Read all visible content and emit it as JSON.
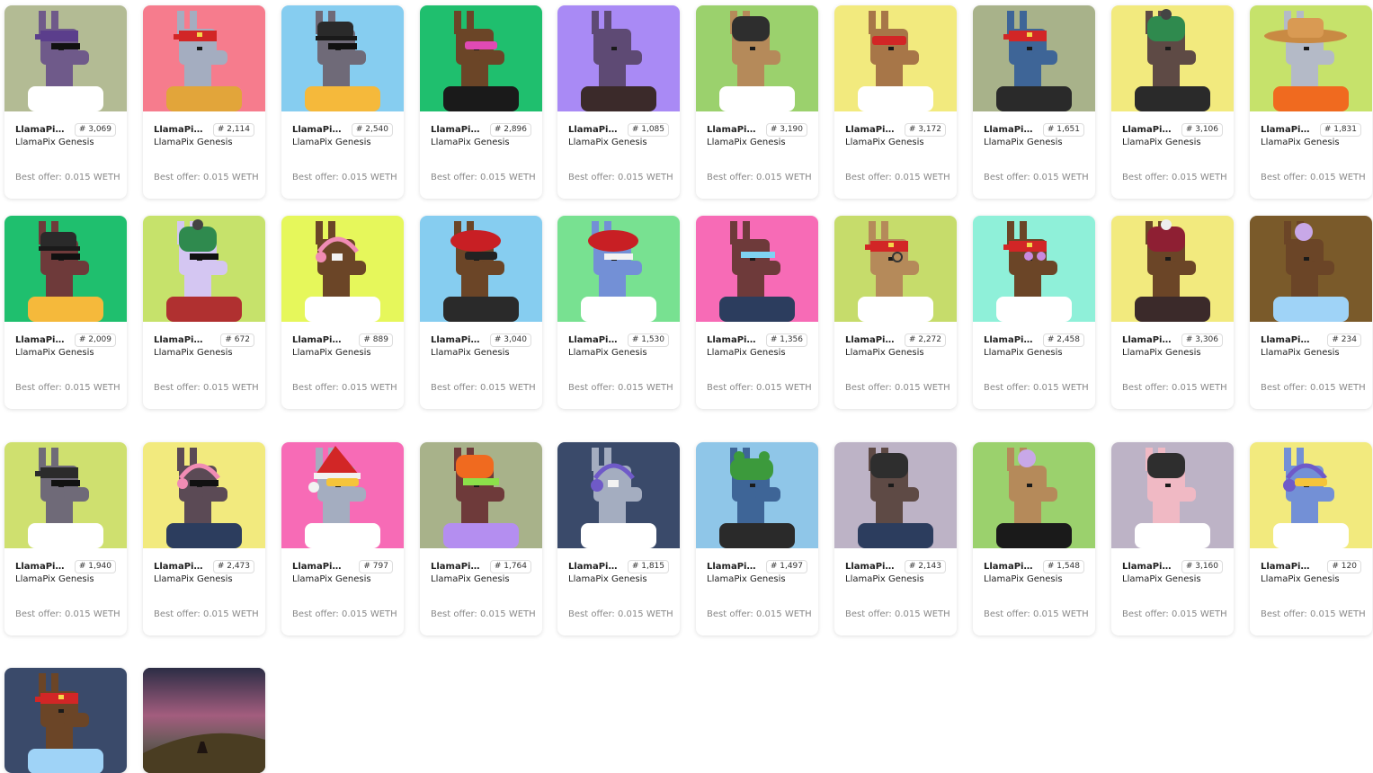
{
  "collection": "LlamaPix Genesis",
  "best_offer_label": "Best offer:",
  "currency": "WETH",
  "items": [
    {
      "name": "LlamaPix #3069",
      "number": "# 3,069",
      "collection": "LlamaPix Genesis",
      "offer": "0.015",
      "bg": "#b3bb94",
      "fur": "#6f5a8a",
      "hat": "bandana-purple",
      "acc": "shades",
      "shirt": "#ffffff"
    },
    {
      "name": "LlamaPix #2114",
      "number": "# 2,114",
      "collection": "LlamaPix Genesis",
      "offer": "0.015",
      "bg": "#f67c8d",
      "fur": "#a4adc0",
      "hat": "bandana-red",
      "acc": "none",
      "shirt": "#e2a53a"
    },
    {
      "name": "LlamaPix #2540",
      "number": "# 2,540",
      "collection": "LlamaPix Genesis",
      "offer": "0.015",
      "bg": "#86cdf0",
      "fur": "#6f6a78",
      "hat": "cap-black",
      "acc": "shades",
      "shirt": "#f5b93b"
    },
    {
      "name": "LlamaPix #2896",
      "number": "# 2,896",
      "collection": "LlamaPix Genesis",
      "offer": "0.015",
      "bg": "#1fbf6e",
      "fur": "#6b4527",
      "hat": "none",
      "acc": "goggles-pink",
      "shirt": "#1a1a1a"
    },
    {
      "name": "LlamaPix #1085",
      "number": "# 1,085",
      "collection": "LlamaPix Genesis",
      "offer": "0.015",
      "bg": "#a98af5",
      "fur": "#5e4a74",
      "hat": "none",
      "acc": "none",
      "shirt": "#3b2a2a"
    },
    {
      "name": "LlamaPix #3190",
      "number": "# 3,190",
      "collection": "LlamaPix Genesis",
      "offer": "0.015",
      "bg": "#9bd16d",
      "fur": "#b58a5a",
      "hat": "beanie-black",
      "acc": "none",
      "shirt": "#ffffff"
    },
    {
      "name": "LlamaPix #3172",
      "number": "# 3,172",
      "collection": "LlamaPix Genesis",
      "offer": "0.015",
      "bg": "#f2ea7e",
      "fur": "#a77648",
      "hat": "goggles-red",
      "acc": "none",
      "shirt": "#ffffff"
    },
    {
      "name": "LlamaPix #1651",
      "number": "# 1,651",
      "collection": "LlamaPix Genesis",
      "offer": "0.015",
      "bg": "#a8b28a",
      "fur": "#3e6597",
      "hat": "bandana-red",
      "acc": "none",
      "shirt": "#2a2a2a"
    },
    {
      "name": "LlamaPix #3106",
      "number": "# 3,106",
      "collection": "LlamaPix Genesis",
      "offer": "0.015",
      "bg": "#f2ea7e",
      "fur": "#5e4a45",
      "hat": "beanie-green",
      "acc": "none",
      "shirt": "#2a2a2a"
    },
    {
      "name": "LlamaPix #1831",
      "number": "# 1,831",
      "collection": "LlamaPix Genesis",
      "offer": "0.015",
      "bg": "#c6e26b",
      "fur": "#b4bac7",
      "hat": "straw",
      "acc": "none",
      "shirt": "#f06a1f"
    },
    {
      "name": "LlamaPix #2009",
      "number": "# 2,009",
      "collection": "LlamaPix Genesis",
      "offer": "0.015",
      "bg": "#1fbf6e",
      "fur": "#6e3a3a",
      "hat": "cap-black",
      "acc": "shades",
      "shirt": "#f5b93b"
    },
    {
      "name": "LlamaPix #672",
      "number": "# 672",
      "collection": "LlamaPix Genesis",
      "offer": "0.015",
      "bg": "#c6e26b",
      "fur": "#d4c6f2",
      "hat": "beanie-green",
      "acc": "shades",
      "shirt": "#b03030"
    },
    {
      "name": "LlamaPix #889",
      "number": "# 889",
      "collection": "LlamaPix Genesis",
      "offer": "0.015",
      "bg": "#e6f75b",
      "fur": "#6b4527",
      "hat": "headphone-pink",
      "acc": "eyepatch",
      "shirt": "#ffffff"
    },
    {
      "name": "LlamaPix #3040",
      "number": "# 3,040",
      "collection": "LlamaPix Genesis",
      "offer": "0.015",
      "bg": "#86cdf0",
      "fur": "#6b4527",
      "hat": "beret-red",
      "acc": "goggles-black",
      "shirt": "#2a2a2a"
    },
    {
      "name": "LlamaPix #1530",
      "number": "# 1,530",
      "collection": "LlamaPix Genesis",
      "offer": "0.015",
      "bg": "#78e191",
      "fur": "#7390d6",
      "hat": "beret-red",
      "acc": "shades-white",
      "shirt": "#ffffff"
    },
    {
      "name": "LlamaPix #1356",
      "number": "# 1,356",
      "collection": "LlamaPix Genesis",
      "offer": "0.015",
      "bg": "#f76bb6",
      "fur": "#6e3a3a",
      "hat": "none",
      "acc": "visor",
      "shirt": "#2c3d5e"
    },
    {
      "name": "LlamaPix #2272",
      "number": "# 2,272",
      "collection": "LlamaPix Genesis",
      "offer": "0.015",
      "bg": "#c6dc6b",
      "fur": "#b58a5a",
      "hat": "bandana-red",
      "acc": "monocle",
      "shirt": "#ffffff"
    },
    {
      "name": "LlamaPix #2458",
      "number": "# 2,458",
      "collection": "LlamaPix Genesis",
      "offer": "0.015",
      "bg": "#8ff0d9",
      "fur": "#6b4527",
      "hat": "bandana-red",
      "acc": "heart-glasses",
      "shirt": "#ffffff"
    },
    {
      "name": "LlamaPix #3306",
      "number": "# 3,306",
      "collection": "LlamaPix Genesis",
      "offer": "0.015",
      "bg": "#f2ea7e",
      "fur": "#6b4527",
      "hat": "beanie-red",
      "acc": "none",
      "shirt": "#3b2a2a"
    },
    {
      "name": "LlamaPix #234",
      "number": "# 234",
      "collection": "LlamaPix Genesis",
      "offer": "0.015",
      "bg": "#7a5a2a",
      "fur": "#6b4527",
      "hat": "octopus",
      "acc": "none",
      "shirt": "#9fd3f7"
    },
    {
      "name": "LlamaPix #1940",
      "number": "# 1,940",
      "collection": "LlamaPix Genesis",
      "offer": "0.015",
      "bg": "#cfe06f",
      "fur": "#6f6a78",
      "hat": "bandana-black",
      "acc": "shades",
      "shirt": "#ffffff"
    },
    {
      "name": "LlamaPix #2473",
      "number": "# 2,473",
      "collection": "LlamaPix Genesis",
      "offer": "0.015",
      "bg": "#f2ea7e",
      "fur": "#5b4a55",
      "hat": "headphone-pink",
      "acc": "shades",
      "shirt": "#2c3d5e"
    },
    {
      "name": "LlamaPix #797",
      "number": "# 797",
      "collection": "LlamaPix Genesis",
      "offer": "0.015",
      "bg": "#f76bb6",
      "fur": "#a4adc0",
      "hat": "santa",
      "acc": "goggles-yellow",
      "shirt": "#ffffff"
    },
    {
      "name": "LlamaPix #1764",
      "number": "# 1,764",
      "collection": "LlamaPix Genesis",
      "offer": "0.015",
      "bg": "#a8b28a",
      "fur": "#6e3a3a",
      "hat": "beanie-orange",
      "acc": "visor-green",
      "shirt": "#b48ef0"
    },
    {
      "name": "LlamaPix #1815",
      "number": "# 1,815",
      "collection": "LlamaPix Genesis",
      "offer": "0.015",
      "bg": "#3a4a6a",
      "fur": "#a4adc0",
      "hat": "headphone-purple",
      "acc": "eyepatch",
      "shirt": "#ffffff"
    },
    {
      "name": "LlamaPix #1497",
      "number": "# 1,497",
      "collection": "LlamaPix Genesis",
      "offer": "0.015",
      "bg": "#8fc6e8",
      "fur": "#3e6597",
      "hat": "frog",
      "acc": "none",
      "shirt": "#2a2a2a"
    },
    {
      "name": "LlamaPix #2143",
      "number": "# 2,143",
      "collection": "LlamaPix Genesis",
      "offer": "0.015",
      "bg": "#bdb3c6",
      "fur": "#5e4a45",
      "hat": "beanie-black",
      "acc": "none",
      "shirt": "#2c3d5e"
    },
    {
      "name": "LlamaPix #1548",
      "number": "# 1,548",
      "collection": "LlamaPix Genesis",
      "offer": "0.015",
      "bg": "#9bd16d",
      "fur": "#b58a5a",
      "hat": "octopus",
      "acc": "none",
      "shirt": "#1a1a1a"
    },
    {
      "name": "LlamaPix #3160",
      "number": "# 3,160",
      "collection": "LlamaPix Genesis",
      "offer": "0.015",
      "bg": "#bdb3c6",
      "fur": "#f0b9c4",
      "hat": "beanie-black",
      "acc": "none",
      "shirt": "#ffffff"
    },
    {
      "name": "LlamaPix #120",
      "number": "# 120",
      "collection": "LlamaPix Genesis",
      "offer": "0.015",
      "bg": "#f2ea7e",
      "fur": "#7390d6",
      "hat": "headphone-purple",
      "acc": "goggles-yellow",
      "shirt": "#ffffff"
    },
    {
      "name": "",
      "number": "",
      "collection": "",
      "offer": "",
      "bg": "#3a4a6a",
      "fur": "#6b4527",
      "hat": "bandana-red",
      "acc": "none",
      "shirt": "#9fd3f7",
      "partial": true
    },
    {
      "name": "",
      "number": "",
      "collection": "",
      "offer": "",
      "bg": "#3b3650",
      "fur": "",
      "hat": "",
      "acc": "",
      "shirt": "",
      "partial": true,
      "photo": true
    }
  ]
}
